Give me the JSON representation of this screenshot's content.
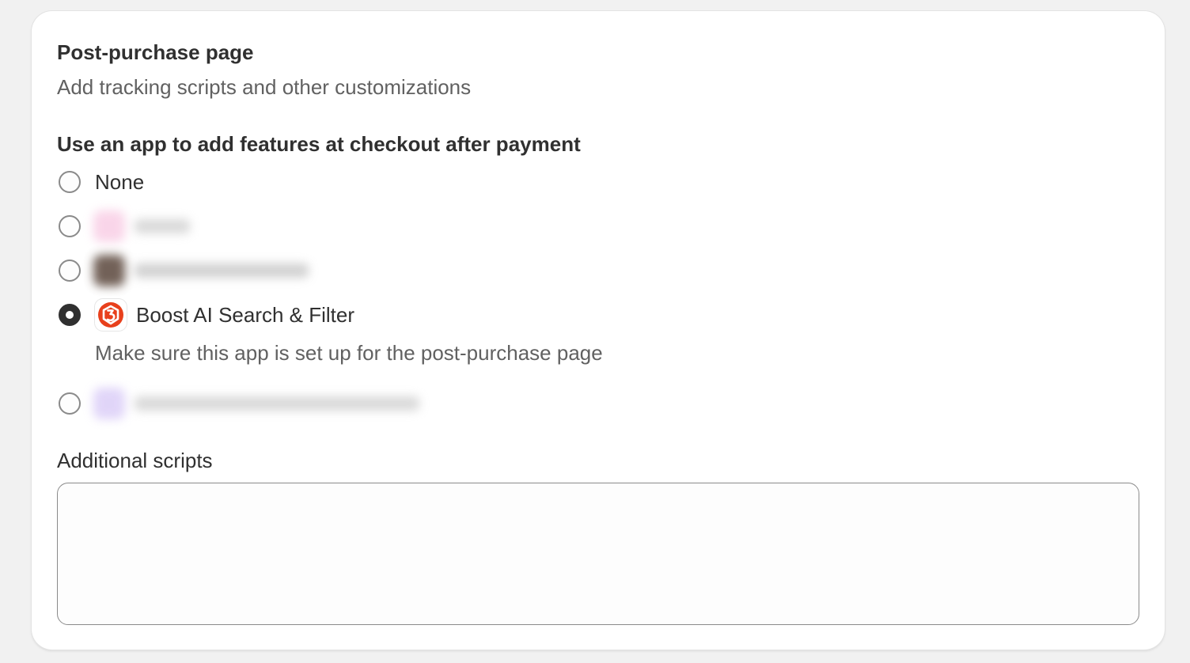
{
  "section": {
    "title": "Post-purchase page",
    "subtitle": "Add tracking scripts and other customizations"
  },
  "app_selector": {
    "label": "Use an app to add features at checkout after payment",
    "options": [
      {
        "label": "None",
        "checked": false
      },
      {
        "label": "",
        "checked": false,
        "blurred": true,
        "icon_color": "#f7b6d9"
      },
      {
        "label": "",
        "checked": false,
        "blurred": true,
        "icon_color": "#6b5447"
      },
      {
        "label": "Boost AI Search & Filter",
        "checked": true,
        "icon": "boost-logo-icon",
        "icon_color": "#e8401c"
      },
      {
        "label": "",
        "checked": false,
        "blurred": true,
        "icon_color": "#c8b6f2"
      }
    ],
    "selected_helper": "Make sure this app is set up for the post-purchase page"
  },
  "additional_scripts": {
    "label": "Additional scripts",
    "value": ""
  },
  "colors": {
    "background": "#f1f1f1",
    "card": "#ffffff",
    "text_primary": "#303030",
    "text_secondary": "#616161",
    "radio_border": "#8a8a8a",
    "brand_boost": "#e8401c"
  }
}
